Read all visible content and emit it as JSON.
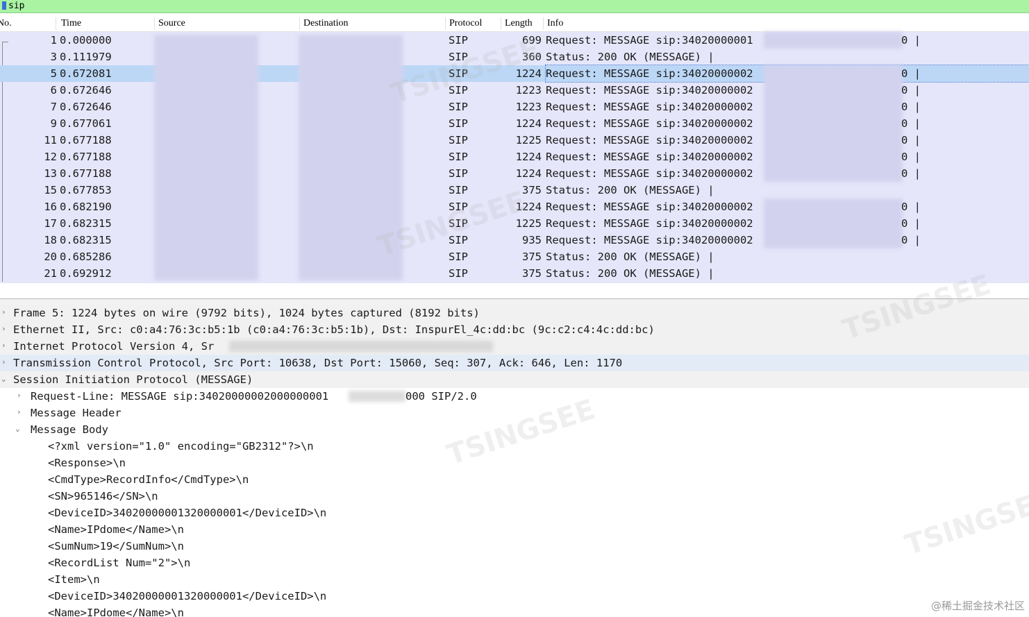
{
  "filter": {
    "value": "sip"
  },
  "columns": [
    "No.",
    "Time",
    "Source",
    "Destination",
    "Protocol",
    "Length",
    "Info"
  ],
  "packets": [
    {
      "no": "1",
      "time": "0.000000",
      "protocol": "SIP",
      "length": "699",
      "info": "Request: MESSAGE sip:34020000001"
    },
    {
      "no": "3",
      "time": "0.111979",
      "protocol": "SIP",
      "length": "360",
      "info": "Status: 200 OK (MESSAGE) |"
    },
    {
      "no": "5",
      "time": "0.672081",
      "protocol": "SIP",
      "length": "1224",
      "info": "Request: MESSAGE sip:34020000002"
    },
    {
      "no": "6",
      "time": "0.672646",
      "protocol": "SIP",
      "length": "1223",
      "info": "Request: MESSAGE sip:34020000002"
    },
    {
      "no": "7",
      "time": "0.672646",
      "protocol": "SIP",
      "length": "1223",
      "info": "Request: MESSAGE sip:34020000002"
    },
    {
      "no": "9",
      "time": "0.677061",
      "protocol": "SIP",
      "length": "1224",
      "info": "Request: MESSAGE sip:34020000002"
    },
    {
      "no": "11",
      "time": "0.677188",
      "protocol": "SIP",
      "length": "1225",
      "info": "Request: MESSAGE sip:34020000002"
    },
    {
      "no": "12",
      "time": "0.677188",
      "protocol": "SIP",
      "length": "1224",
      "info": "Request: MESSAGE sip:34020000002"
    },
    {
      "no": "13",
      "time": "0.677188",
      "protocol": "SIP",
      "length": "1224",
      "info": "Request: MESSAGE sip:34020000002"
    },
    {
      "no": "15",
      "time": "0.677853",
      "protocol": "SIP",
      "length": "375",
      "info": "Status: 200 OK (MESSAGE) |"
    },
    {
      "no": "16",
      "time": "0.682190",
      "protocol": "SIP",
      "length": "1224",
      "info": "Request: MESSAGE sip:34020000002"
    },
    {
      "no": "17",
      "time": "0.682315",
      "protocol": "SIP",
      "length": "1225",
      "info": "Request: MESSAGE sip:34020000002"
    },
    {
      "no": "18",
      "time": "0.682315",
      "protocol": "SIP",
      "length": "935",
      "info": "Request: MESSAGE sip:34020000002"
    },
    {
      "no": "20",
      "time": "0.685286",
      "protocol": "SIP",
      "length": "375",
      "info": "Status: 200 OK (MESSAGE) |"
    },
    {
      "no": "21",
      "time": "0.692912",
      "protocol": "SIP",
      "length": "375",
      "info": "Status: 200 OK (MESSAGE) |"
    }
  ],
  "info_tails": [
    "0 |",
    "0 |",
    "0 |",
    "0 |",
    "0 |",
    "0 |",
    "0 |",
    "0 |",
    "0 |",
    "0 |",
    "0 |"
  ],
  "details": [
    {
      "text": "Frame 5: 1224 bytes on wire (9792 bits), 1024 bytes captured (8192 bits)",
      "toggle": "collapsed"
    },
    {
      "text": "Ethernet II, Src: c0:a4:76:3c:b5:1b (c0:a4:76:3c:b5:1b), Dst: InspurEl_4c:dd:bc (9c:c2:c4:4c:dd:bc)",
      "toggle": "collapsed"
    },
    {
      "text": "Internet Protocol Version 4, Sr",
      "toggle": "collapsed"
    },
    {
      "text": "Transmission Control Protocol, Src Port: 10638, Dst Port: 15060, Seq: 307, Ack: 646, Len: 1170",
      "toggle": "collapsed"
    },
    {
      "text": "Session Initiation Protocol (MESSAGE)",
      "toggle": "expanded"
    },
    {
      "text": "Request-Line: MESSAGE sip:34020000002000000001",
      "tail": "000 SIP/2.0",
      "toggle": "collapsed"
    },
    {
      "text": "Message Header",
      "toggle": "collapsed"
    },
    {
      "text": "Message Body",
      "toggle": "expanded"
    },
    {
      "text": "<?xml version=\"1.0\" encoding=\"GB2312\"?>\\n",
      "toggle": "none"
    },
    {
      "text": "<Response>\\n",
      "toggle": "none"
    },
    {
      "text": "<CmdType>RecordInfo</CmdType>\\n",
      "toggle": "none"
    },
    {
      "text": "<SN>965146</SN>\\n",
      "toggle": "none"
    },
    {
      "text": "<DeviceID>34020000001320000001</DeviceID>\\n",
      "toggle": "none"
    },
    {
      "text": "<Name>IPdome</Name>\\n",
      "toggle": "none"
    },
    {
      "text": "<SumNum>19</SumNum>\\n",
      "toggle": "none"
    },
    {
      "text": "<RecordList Num=\"2\">\\n",
      "toggle": "none"
    },
    {
      "text": "<Item>\\n",
      "toggle": "none"
    },
    {
      "text": "<DeviceID>34020000001320000001</DeviceID>\\n",
      "toggle": "none"
    },
    {
      "text": "<Name>IPdome</Name>\\n",
      "toggle": "none"
    }
  ],
  "watermark": "TSINGSEE",
  "credit": "@稀土掘金技术社区",
  "colors": {
    "filter_bg": "#a9f3a3",
    "packet_bg": "#e6e6fa",
    "selected_bg": "#bcd7f6",
    "detail_highlight": "#e3ebf7"
  }
}
